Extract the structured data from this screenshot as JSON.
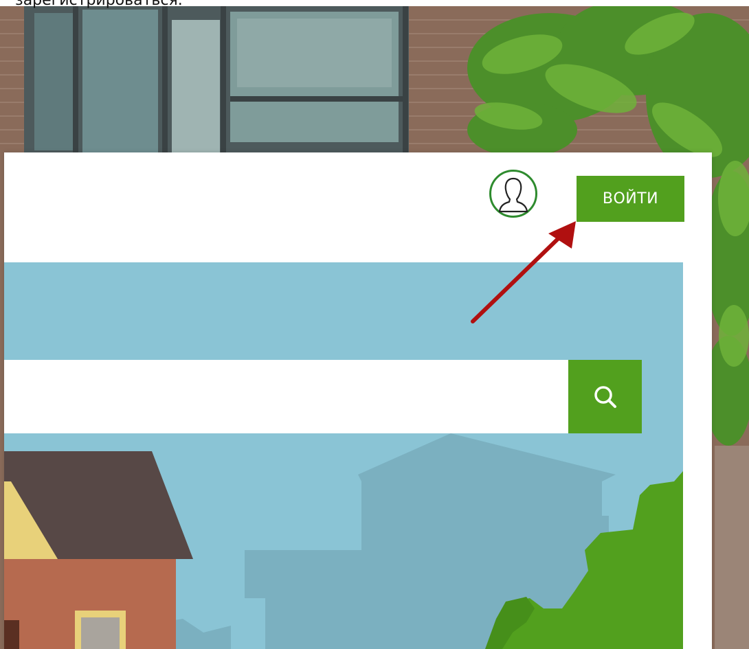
{
  "instruction": {
    "text": "зарегистрироваться."
  },
  "header": {
    "login_label": "ВОЙТИ"
  },
  "search": {
    "value": "",
    "placeholder": ""
  },
  "colors": {
    "accent_green": "#52a01e",
    "hero_sky": "#8ac4d5",
    "annotation_arrow": "#b01010"
  },
  "icons": {
    "profile": "user-profile-icon",
    "search": "magnifier-icon",
    "annotation": "red-arrow"
  }
}
